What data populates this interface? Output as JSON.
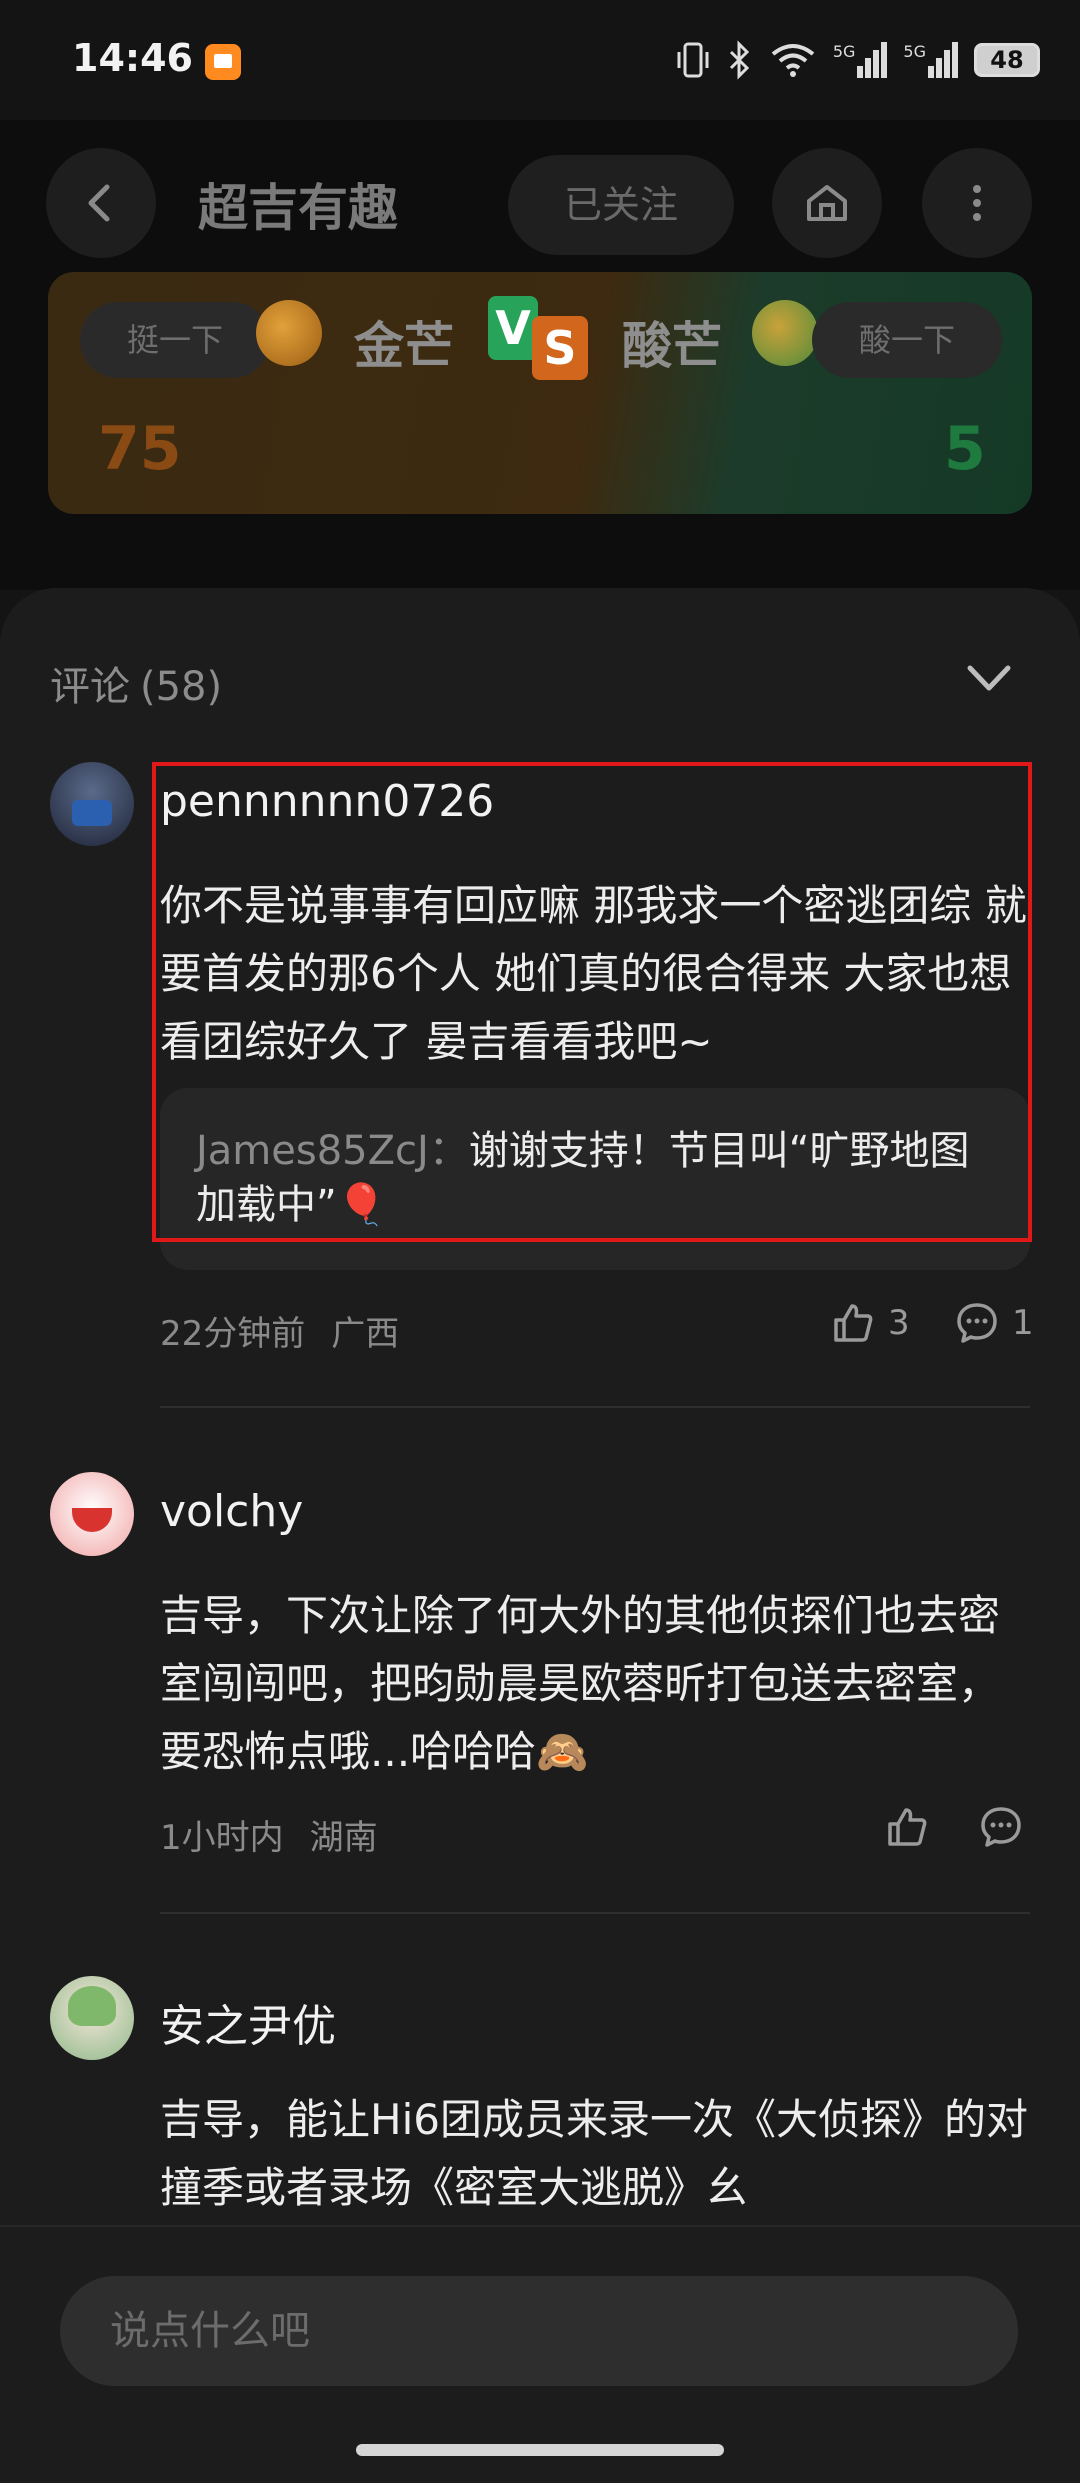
{
  "status_bar": {
    "time": "14:46",
    "battery": "48",
    "network_1": "5G",
    "network_2": "5G"
  },
  "header": {
    "title": "超吉有趣",
    "follow_label": "已关注",
    "icons": [
      "back-icon",
      "home-icon",
      "more-icon"
    ]
  },
  "vs": {
    "left_button": "挺一下",
    "left_name": "金芒",
    "left_score": "75",
    "right_button": "酸一下",
    "right_name": "酸芒",
    "right_score": "5",
    "badge_v": "V",
    "badge_s": "S",
    "colors": {
      "left": "#c8681a",
      "right": "#2fae5a"
    }
  },
  "comments_header": {
    "title": "评论",
    "count": "(58)"
  },
  "comments": [
    {
      "user": "pennnnnn0726",
      "text": "你不是说事事有回应嘛 那我求一个密逃团综 就要首发的那6个人 她们真的很合得来 大家也想看团综好久了 晏吉看看我吧~",
      "reply_user": "James85ZcJ：",
      "reply_text": "谢谢支持！节目叫“旷野地图加载中”🎈",
      "time": "22分钟前",
      "location": "广西",
      "likes": "3",
      "replies": "1"
    },
    {
      "user": "volchy",
      "text": "吉导，下次让除了何大外的其他侦探们也去密室闯闯吧，把昀勋晨昊欧蓉昕打包送去密室，要恐怖点哦...哈哈哈🙈",
      "time": "1小时内",
      "location": "湖南"
    },
    {
      "user": "安之尹优",
      "text": "吉导，能让Hi6团成员来录一次《大侦探》的对撞季或者录场《密室大逃脱》幺"
    }
  ],
  "input": {
    "placeholder": "说点什么吧"
  }
}
